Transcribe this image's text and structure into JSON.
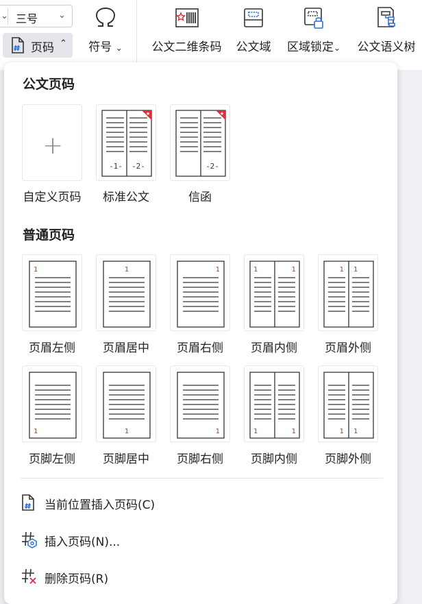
{
  "ribbon": {
    "font_size_value": "三号",
    "page_number_button": "页码",
    "symbol_button": "符号",
    "tools": [
      {
        "label": "公文二维条码",
        "icon": "barcode-icon"
      },
      {
        "label": "公文域",
        "icon": "document-field-icon"
      },
      {
        "label": "区域锁定",
        "icon": "area-lock-icon"
      },
      {
        "label": "公文语义树",
        "icon": "semantic-tree-icon"
      }
    ]
  },
  "panel": {
    "official_section_title": "公文页码",
    "official_items": [
      {
        "label": "自定义页码",
        "kind": "custom"
      },
      {
        "label": "标准公文",
        "kind": "double",
        "numbers": [
          "-1-",
          "-2-"
        ]
      },
      {
        "label": "信函",
        "kind": "single",
        "numbers": [
          "-2-"
        ]
      }
    ],
    "normal_section_title": "普通页码",
    "header_items": [
      {
        "label": "页眉左侧",
        "digit": "1"
      },
      {
        "label": "页眉居中",
        "digit": "1"
      },
      {
        "label": "页眉右侧",
        "digit": "1"
      },
      {
        "label": "页眉内侧",
        "digit": "1"
      },
      {
        "label": "页眉外侧",
        "digit": "1"
      }
    ],
    "footer_items": [
      {
        "label": "页脚左侧",
        "digit": "1"
      },
      {
        "label": "页脚居中",
        "digit": "1"
      },
      {
        "label": "页脚右侧",
        "digit": "1"
      },
      {
        "label": "页脚内侧",
        "digit": "1"
      },
      {
        "label": "页脚外侧",
        "digit": "1"
      }
    ],
    "menu": [
      {
        "label": "当前位置插入页码(C)",
        "icon": "insert-page-number-here-icon"
      },
      {
        "label": "插入页码(N)...",
        "icon": "insert-page-number-icon"
      },
      {
        "label": "删除页码(R)",
        "icon": "delete-page-number-icon"
      }
    ]
  },
  "colors": {
    "accent": "#d9303a",
    "icon_blue": "#2b6fd6",
    "digit_brown": "#8b4a2b"
  }
}
